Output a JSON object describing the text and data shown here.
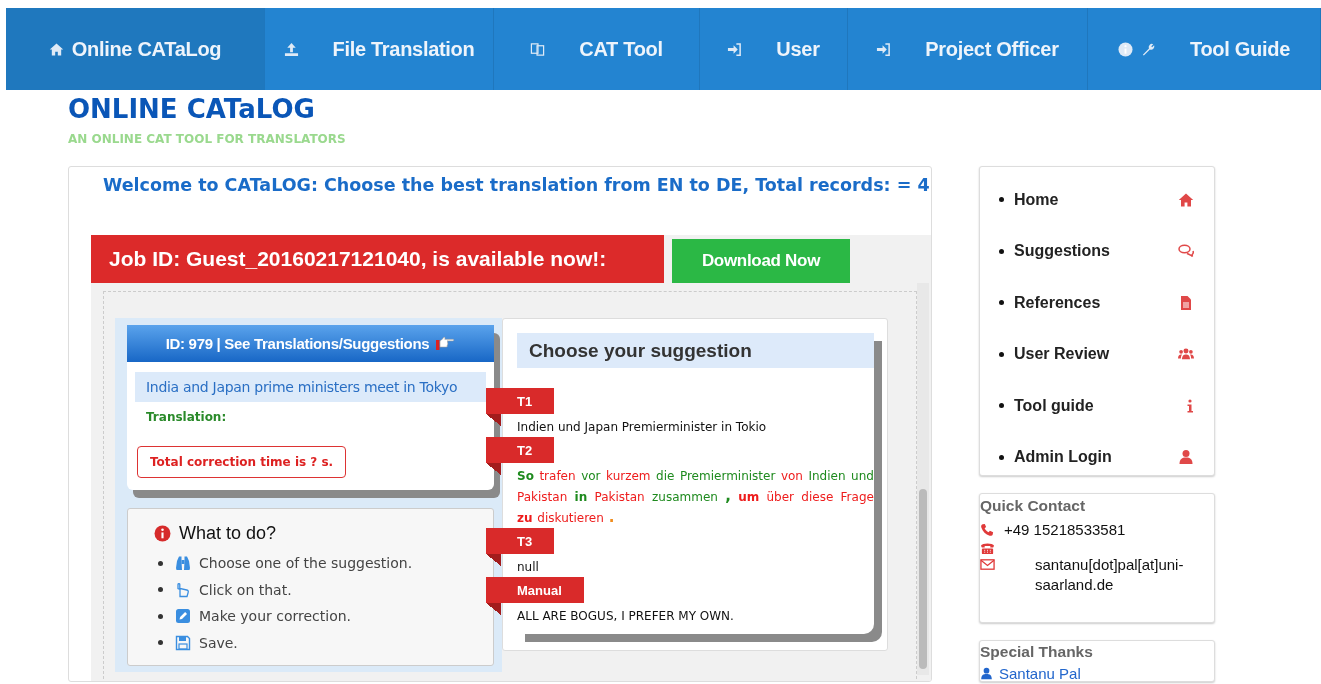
{
  "nav": [
    {
      "label": "Online CATaLog",
      "selected": true
    },
    {
      "label": "File Translation",
      "selected": false
    },
    {
      "label": "CAT Tool",
      "selected": false
    },
    {
      "label": "User",
      "selected": false
    },
    {
      "label": "Project Officer",
      "selected": false
    },
    {
      "label": "Tool Guide",
      "selected": false
    }
  ],
  "header": {
    "title": "ONLINE CATaLOG",
    "subtitle": "AN ONLINE CAT TOOL FOR TRANSLATORS"
  },
  "main": {
    "welcome": "Welcome to CATaLOG: Choose the best translation from EN to DE, Total records: = 4",
    "job_notice": "Job ID: Guest_20160217121040, is available now!:",
    "download_button": "Download Now",
    "segment": {
      "header": "ID: 979 | See Translations/Suggestions",
      "source": "India and Japan prime ministers meet in Tokyo",
      "translation_label": "Translation:",
      "timer": "Total correction time is ? s."
    },
    "instructions": {
      "title": "What to do?",
      "steps": [
        "Choose one of the suggestion.",
        "Click on that.",
        "Make your correction.",
        "Save."
      ]
    },
    "suggestions": {
      "title": "Choose your suggestion",
      "items": [
        {
          "tag": "T1",
          "text": "Indien und Japan Premierminister in Tokio"
        },
        {
          "tag": "T2",
          "tokens": [
            {
              "text": "So",
              "color": "#1e8a1e"
            },
            {
              "text": "trafen",
              "color": "#ee1c1c"
            },
            {
              "text": "vor",
              "color": "#1e8a1e"
            },
            {
              "text": "kurzem",
              "color": "#ee1c1c"
            },
            {
              "text": "die",
              "color": "#1e8a1e"
            },
            {
              "text": "Premierminister",
              "color": "#1e8a1e"
            },
            {
              "text": "von",
              "color": "#ee1c1c"
            },
            {
              "text": "Indien",
              "color": "#1e8a1e"
            },
            {
              "text": "und",
              "color": "#1e8a1e"
            },
            {
              "text": "Pakistan",
              "color": "#ee1c1c"
            },
            {
              "text": "in",
              "color": "#1e8a1e"
            },
            {
              "text": "Pakistan",
              "color": "#ee1c1c"
            },
            {
              "text": "zusammen",
              "color": "#1e8a1e"
            },
            {
              "text": ",",
              "color": "#1e8a1e"
            },
            {
              "text": "um",
              "color": "#ee1c1c"
            },
            {
              "text": "über",
              "color": "#ee1c1c"
            },
            {
              "text": "diese",
              "color": "#ee1c1c"
            },
            {
              "text": "Frage",
              "color": "#ee1c1c"
            },
            {
              "text": "zu",
              "color": "#ee1c1c"
            },
            {
              "text": "diskutieren",
              "color": "#ee1c1c"
            },
            {
              "text": ".",
              "color": "#f08c1c"
            }
          ]
        },
        {
          "tag": "T3",
          "text": "null"
        },
        {
          "tag": "Manual",
          "text": "ALL ARE BOGUS, I PREFER MY OWN."
        }
      ]
    }
  },
  "sidebar": {
    "items": [
      "Home",
      "Suggestions",
      "References",
      "User Review",
      "Tool guide",
      "Admin Login"
    ]
  },
  "quick_contact": {
    "title": "Quick Contact",
    "phone": "+49 15218533581",
    "email": "santanu[dot]pal[at]uni-saarland.de"
  },
  "special_thanks": {
    "title": "Special Thanks",
    "people": [
      "Santanu Pal"
    ]
  }
}
